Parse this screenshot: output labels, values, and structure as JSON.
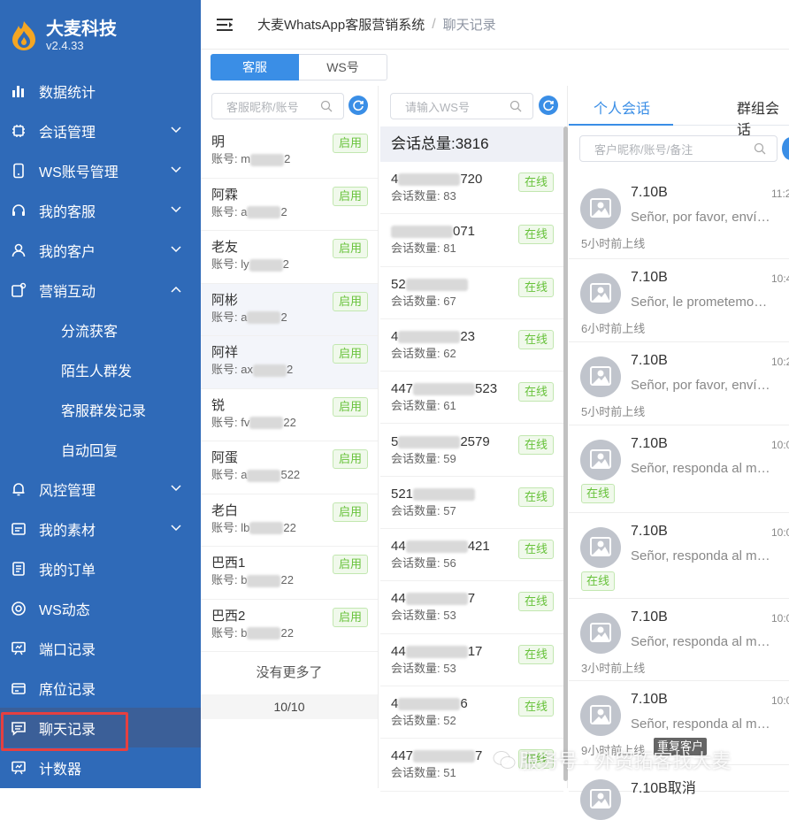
{
  "brand": {
    "name": "大麦科技",
    "version": "v2.4.33"
  },
  "sidebar": {
    "items": [
      {
        "label": "数据统计",
        "icon": "bar-chart-icon",
        "chevron": false
      },
      {
        "label": "会话管理",
        "icon": "chip-icon",
        "chevron": "down"
      },
      {
        "label": "WS账号管理",
        "icon": "phone-icon",
        "chevron": "down"
      },
      {
        "label": "我的客服",
        "icon": "headset-icon",
        "chevron": "down"
      },
      {
        "label": "我的客户",
        "icon": "user-icon",
        "chevron": "down"
      },
      {
        "label": "营销互动",
        "icon": "share-icon",
        "chevron": "up"
      },
      {
        "label": "分流获客",
        "sub": true
      },
      {
        "label": "陌生人群发",
        "sub": true
      },
      {
        "label": "客服群发记录",
        "sub": true
      },
      {
        "label": "自动回复",
        "sub": true
      },
      {
        "label": "风控管理",
        "icon": "bell-icon",
        "chevron": "down"
      },
      {
        "label": "我的素材",
        "icon": "media-icon",
        "chevron": "down"
      },
      {
        "label": "我的订单",
        "icon": "order-icon",
        "chevron": false
      },
      {
        "label": "WS动态",
        "icon": "lifebuoy-icon",
        "chevron": false
      },
      {
        "label": "端口记录",
        "icon": "board-icon",
        "chevron": false
      },
      {
        "label": "席位记录",
        "icon": "card-icon",
        "chevron": false
      },
      {
        "label": "聊天记录",
        "icon": "chat-icon",
        "chevron": false,
        "active": true
      },
      {
        "label": "计数器",
        "icon": "board-icon",
        "chevron": false
      }
    ]
  },
  "header": {
    "title": "大麦WhatsApp客服营销系统",
    "separator": "/",
    "current": "聊天记录"
  },
  "toptabs": [
    "客服",
    "WS号"
  ],
  "agents": {
    "search_placeholder": "客服昵称/账号",
    "status_label": "启用",
    "list": [
      {
        "name": "明",
        "account_prefix": "账号: m",
        "account_suffix": "2"
      },
      {
        "name": "阿霖",
        "account_prefix": "账号: a",
        "account_suffix": "2"
      },
      {
        "name": "老友",
        "account_prefix": "账号: ly",
        "account_suffix": "2"
      },
      {
        "name": "阿彬",
        "account_prefix": "账号: a",
        "account_suffix": "2"
      },
      {
        "name": "阿祥",
        "account_prefix": "账号: ax",
        "account_suffix": "2"
      },
      {
        "name": "锐",
        "account_prefix": "账号: fv",
        "account_suffix": "22"
      },
      {
        "name": "阿蛋",
        "account_prefix": "账号: a",
        "account_suffix": "522"
      },
      {
        "name": "老白",
        "account_prefix": "账号: lb",
        "account_suffix": "22"
      },
      {
        "name": "巴西1",
        "account_prefix": "账号: b",
        "account_suffix": "22"
      },
      {
        "name": "巴西2",
        "account_prefix": "账号: b",
        "account_suffix": "22"
      }
    ],
    "no_more": "没有更多了",
    "pager": "10/10"
  },
  "ws": {
    "search_placeholder": "请输入WS号",
    "total_label": "会话总量:3816",
    "status_label": "在线",
    "count_prefix": "会话数量: ",
    "list": [
      {
        "num_prefix": "4",
        "num_suffix": "720",
        "count": "83"
      },
      {
        "num_prefix": "",
        "num_suffix": "071",
        "count": "81"
      },
      {
        "num_prefix": "52",
        "num_suffix": "",
        "count": "67"
      },
      {
        "num_prefix": "4",
        "num_suffix": "23",
        "count": "62"
      },
      {
        "num_prefix": "447",
        "num_suffix": "523",
        "count": "61"
      },
      {
        "num_prefix": "5",
        "num_suffix": "2579",
        "count": "59"
      },
      {
        "num_prefix": "521",
        "num_suffix": "",
        "count": "57"
      },
      {
        "num_prefix": "44",
        "num_suffix": "421",
        "count": "56"
      },
      {
        "num_prefix": "44",
        "num_suffix": "7",
        "count": "53"
      },
      {
        "num_prefix": "44",
        "num_suffix": "17",
        "count": "53"
      },
      {
        "num_prefix": "4",
        "num_suffix": "6",
        "count": "52"
      },
      {
        "num_prefix": "447",
        "num_suffix": "7",
        "count": "51"
      }
    ]
  },
  "conversations": {
    "tabs": [
      "个人会话",
      "群组会话"
    ],
    "search_placeholder": "客户昵称/账号/备注",
    "list": [
      {
        "name": "7.10B",
        "msg": "Señor, por favor, enví…",
        "time": "11:2",
        "status": "5小时前上线",
        "online": false
      },
      {
        "name": "7.10B",
        "msg": "Señor, le prometemo…",
        "time": "10:4",
        "status": "6小时前上线",
        "online": false
      },
      {
        "name": "7.10B",
        "msg": "Señor, por favor, enví…",
        "time": "10:2",
        "status": "5小时前上线",
        "online": false
      },
      {
        "name": "7.10B",
        "msg": "Señor, responda al m…",
        "time": "10:0",
        "status": "在线",
        "online": true
      },
      {
        "name": "7.10B",
        "msg": "Señor, responda al m…",
        "time": "10:0",
        "status": "在线",
        "online": true
      },
      {
        "name": "7.10B",
        "msg": "Señor, responda al m…",
        "time": "10:0",
        "status": "3小时前上线",
        "online": false
      },
      {
        "name": "7.10B",
        "msg": "Señor, responda al m…",
        "time": "10:0",
        "status": "9小时前上线",
        "online": false
      },
      {
        "name": "7.10B取消",
        "msg": "",
        "time": "",
        "status": "",
        "online": false
      }
    ],
    "tooltip": "重复客户"
  },
  "watermark": "服务号 · 外贸拓客找大麦",
  "colors": {
    "sidebar": "#2f6ab8",
    "accent": "#3a8ee6",
    "online": "#67c23a",
    "highlight": "#e64040"
  }
}
